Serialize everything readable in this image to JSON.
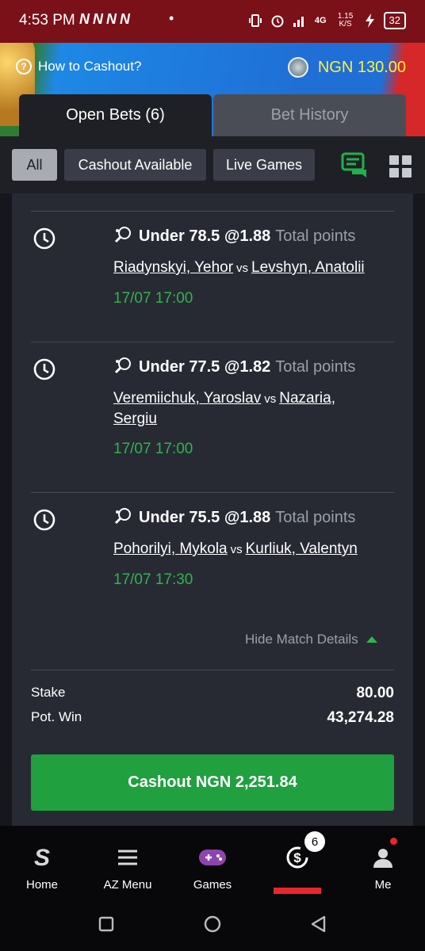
{
  "status_bar": {
    "time": "4:53 PM",
    "app_icons": "NNNN",
    "dot": "•",
    "network": "4G",
    "speed": "1.15 K/S",
    "battery": "32"
  },
  "banner": {
    "how_to_label": "How to Cashout?",
    "balance": "NGN 130.00"
  },
  "tabs": {
    "open_bets": "Open Bets (6)",
    "bet_history": "Bet History"
  },
  "filters": {
    "all": "All",
    "cashout_available": "Cashout Available",
    "live_games": "Live Games"
  },
  "bets": [
    {
      "selection": "Under 78.5 @1.88",
      "market": "Total points",
      "home": "Riadynskyi, Yehor",
      "vs": "vs",
      "away": "Levshyn, Anatolii",
      "date": "17/07 17:00"
    },
    {
      "selection": "Under 77.5 @1.82",
      "market": "Total points",
      "home": "Veremiichuk, Yaroslav",
      "vs": "vs",
      "away": "Nazaria, Sergiu",
      "date": "17/07 17:00"
    },
    {
      "selection": "Under 75.5 @1.88",
      "market": "Total points",
      "home": "Pohorilyi, Mykola",
      "vs": "vs",
      "away": "Kurliuk, Valentyn",
      "date": "17/07 17:30"
    }
  ],
  "hide_details": "Hide Match Details",
  "summary": {
    "stake_label": "Stake",
    "stake_value": "80.00",
    "pot_win_label": "Pot. Win",
    "pot_win_value": "43,274.28"
  },
  "cashout_button": "Cashout NGN 2,251.84",
  "bottom_nav": {
    "home": "Home",
    "az_menu": "AZ Menu",
    "games": "Games",
    "cashout_badge": "6",
    "me": "Me"
  },
  "colors": {
    "accent_green": "#20a03f",
    "balance_yellow": "#fff13c",
    "status_bar": "#7a1018",
    "active_indicator": "#e8262b"
  }
}
